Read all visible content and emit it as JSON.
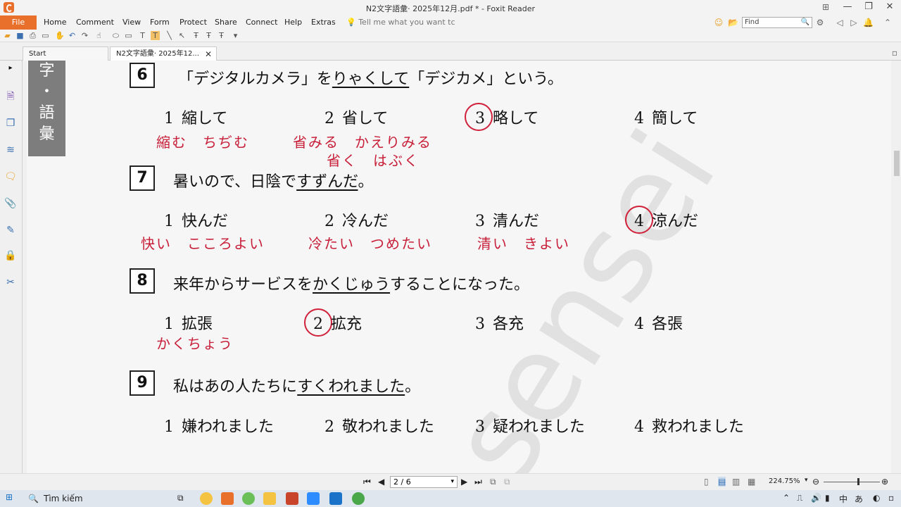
{
  "window": {
    "title": "N2文字語彙· 2025年12月.pdf * - Foxit Reader"
  },
  "menu": {
    "file": "File",
    "items": [
      "Home",
      "Comment",
      "View",
      "Form",
      "Protect",
      "Share",
      "Connect",
      "Help",
      "Extras"
    ],
    "tell_me": "Tell me what you want tc",
    "find_placeholder": "Find"
  },
  "tabs": [
    {
      "label": "Start"
    },
    {
      "label": "N2文字語彙· 2025年12..."
    }
  ],
  "sidebar_label": [
    "字",
    "・",
    "語",
    "彙"
  ],
  "questions": [
    {
      "num": "6",
      "pre": "「デジタルカメラ」を",
      "underline": "りゃくして",
      "post": "「デジカメ」という。",
      "options": [
        {
          "n": "1",
          "t": "縮して"
        },
        {
          "n": "2",
          "t": "省して"
        },
        {
          "n": "3",
          "t": "略して"
        },
        {
          "n": "4",
          "t": "簡して"
        }
      ],
      "answer": "3",
      "notes": [
        "縮む　ちぢむ",
        "省みる　かえりみる",
        "省く　はぶく"
      ]
    },
    {
      "num": "7",
      "pre": "暑いので、日陰で",
      "underline": "すずんだ",
      "post": "。",
      "options": [
        {
          "n": "1",
          "t": "快んだ"
        },
        {
          "n": "2",
          "t": "冷んだ"
        },
        {
          "n": "3",
          "t": "清んだ"
        },
        {
          "n": "4",
          "t": "涼んだ"
        }
      ],
      "answer": "4",
      "notes": [
        "快い　こころよい",
        "冷たい　つめたい",
        "清い　きよい"
      ]
    },
    {
      "num": "8",
      "pre": "来年からサービスを",
      "underline": "かくじゅう",
      "post": "することになった。",
      "options": [
        {
          "n": "1",
          "t": "拡張"
        },
        {
          "n": "2",
          "t": "拡充"
        },
        {
          "n": "3",
          "t": "各充"
        },
        {
          "n": "4",
          "t": "各張"
        }
      ],
      "answer": "2",
      "notes": [
        "かくちょう"
      ]
    },
    {
      "num": "9",
      "pre": "私はあの人たちに",
      "underline": "すくわれました",
      "post": "。",
      "options": [
        {
          "n": "1",
          "t": "嫌われました"
        },
        {
          "n": "2",
          "t": "敬われました"
        },
        {
          "n": "3",
          "t": "疑われました"
        },
        {
          "n": "4",
          "t": "救われました"
        }
      ]
    }
  ],
  "status": {
    "page": "2 / 6",
    "zoom": "224.75%"
  },
  "taskbar": {
    "search": "Tìm kiếm"
  }
}
